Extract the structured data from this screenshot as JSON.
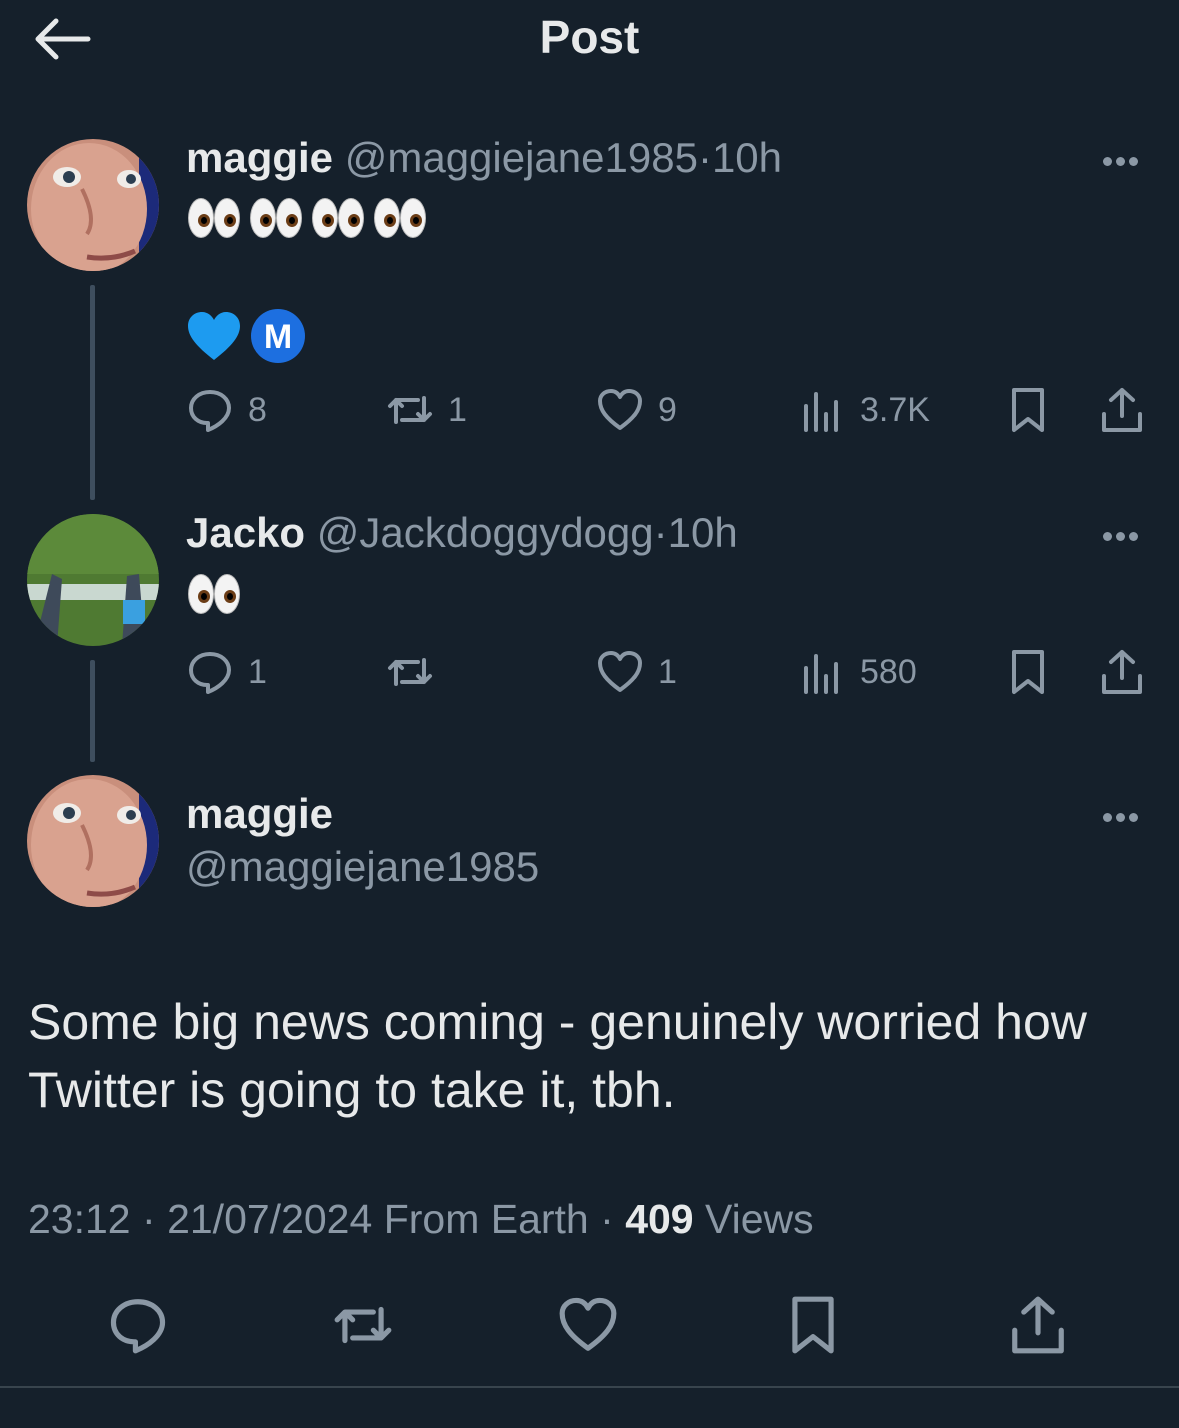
{
  "header": {
    "title": "Post"
  },
  "tweets": [
    {
      "name": "maggie",
      "handle": "@maggiejane1985",
      "separator": "·",
      "time": "10h",
      "emoji_line": "👀👀👀👀",
      "emoji_line2": "💙 Ⓜ️",
      "badge_letter": "M",
      "replies": "8",
      "retweets": "1",
      "likes": "9",
      "views": "3.7K"
    },
    {
      "name": "Jacko",
      "handle": "@Jackdoggydogg",
      "separator": "·",
      "time": "10h",
      "emoji_line": "👀",
      "replies": "1",
      "retweets": "",
      "likes": "1",
      "views": "580"
    }
  ],
  "main_post": {
    "name": "maggie",
    "handle": "@maggiejane1985",
    "text": "Some big news coming - genuinely worried how Twitter is going to take it, tbh.",
    "time": "23:12",
    "date": "21/07/2024",
    "source": "From Earth",
    "separator": "·",
    "views_count": "409",
    "views_label": "Views"
  },
  "icons": {
    "back": "arrow-left-icon",
    "reply": "reply-bubble-icon",
    "retweet": "retweet-icon",
    "like": "heart-icon",
    "views": "bar-chart-icon",
    "bookmark": "bookmark-icon",
    "share": "share-upload-icon",
    "more": "more-horizontal-icon"
  },
  "colors": {
    "background": "#15202b",
    "text": "#e7e9ea",
    "secondary": "#8b98a5",
    "heart_emoji": "#1d9bf0"
  }
}
